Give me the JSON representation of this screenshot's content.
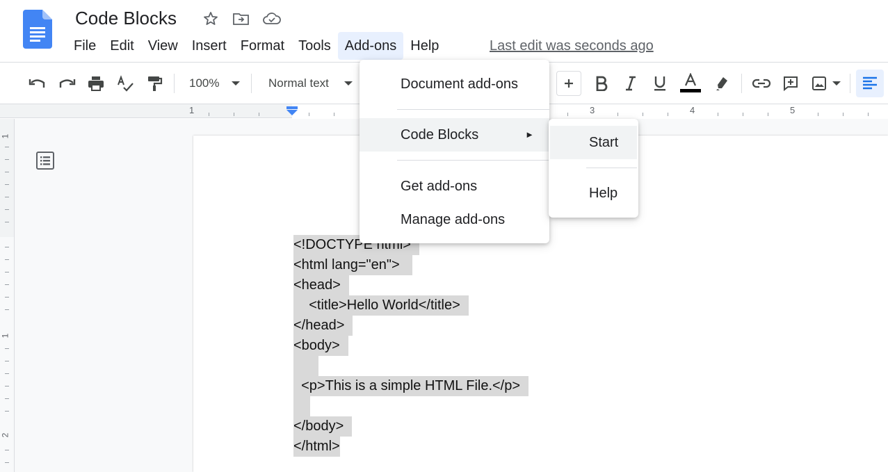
{
  "app": {
    "doc_title": "Code Blocks",
    "last_edit": "Last edit was seconds ago"
  },
  "menubar": {
    "items": [
      "File",
      "Edit",
      "View",
      "Insert",
      "Format",
      "Tools",
      "Add-ons",
      "Help"
    ],
    "active": "Add-ons"
  },
  "toolbar": {
    "zoom": "100%",
    "style": "Normal text",
    "text_color": "#000000",
    "accent": "#1a73e8"
  },
  "ruler": {
    "numbers": [
      "1",
      "3",
      "4",
      "5"
    ]
  },
  "vruler": {
    "numbers": [
      "1",
      "1",
      "2"
    ]
  },
  "addons_menu": {
    "items": [
      {
        "label": "Document add-ons"
      },
      {
        "label": "Code Blocks",
        "has_submenu": true,
        "arrow": "►"
      },
      {
        "label": "Get add-ons"
      },
      {
        "label": "Manage add-ons"
      }
    ]
  },
  "submenu": {
    "items": [
      {
        "label": "Start"
      },
      {
        "label": "Help"
      }
    ]
  },
  "document": {
    "lines": [
      "<!DOCTYPE html>",
      "<html lang=\"en\">",
      "<head>",
      "    <title>Hello World</title>",
      "</head>",
      "<body>",
      "",
      "  <p>This is a simple HTML File.</p>",
      "",
      "</body>",
      "</html>"
    ]
  }
}
